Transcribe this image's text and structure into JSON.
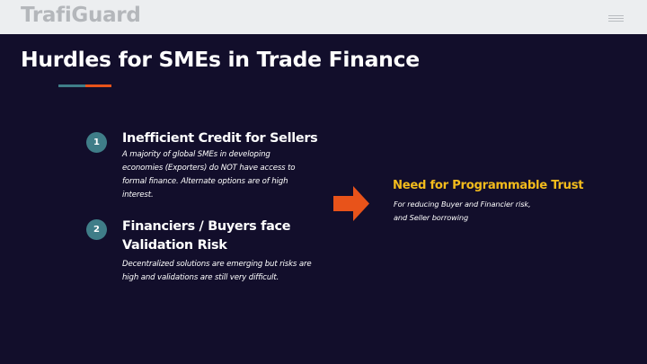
{
  "brand": "TrafiGuard",
  "title": "Hurdles for SMEs in Trade Finance",
  "colors": {
    "background": "#120e2b",
    "topbar": "#eceef0",
    "teal": "#3f7d88",
    "orange": "#e8531a",
    "highlight": "#f2bb1c"
  },
  "items": [
    {
      "number": "1",
      "title_lines": [
        "Inefficient Credit for Sellers"
      ],
      "description_lines": [
        "A majority of global SMEs in developing",
        "economies (Exporters)  do NOT have access to",
        "formal finance. Alternate options are of high",
        "interest."
      ]
    },
    {
      "number": "2",
      "title_lines": [
        "Financiers / Buyers face",
        "Validation Risk"
      ],
      "description_lines": [
        "Decentralized solutions are emerging but risks are",
        "high and validations are still very difficult."
      ]
    }
  ],
  "conclusion": {
    "title": "Need for Programmable Trust",
    "description_lines": [
      "For reducing Buyer and Financier risk,",
      "and Seller borrowing"
    ]
  },
  "icons": {
    "menu": "hamburger-icon",
    "arrow": "right-arrow-icon"
  }
}
